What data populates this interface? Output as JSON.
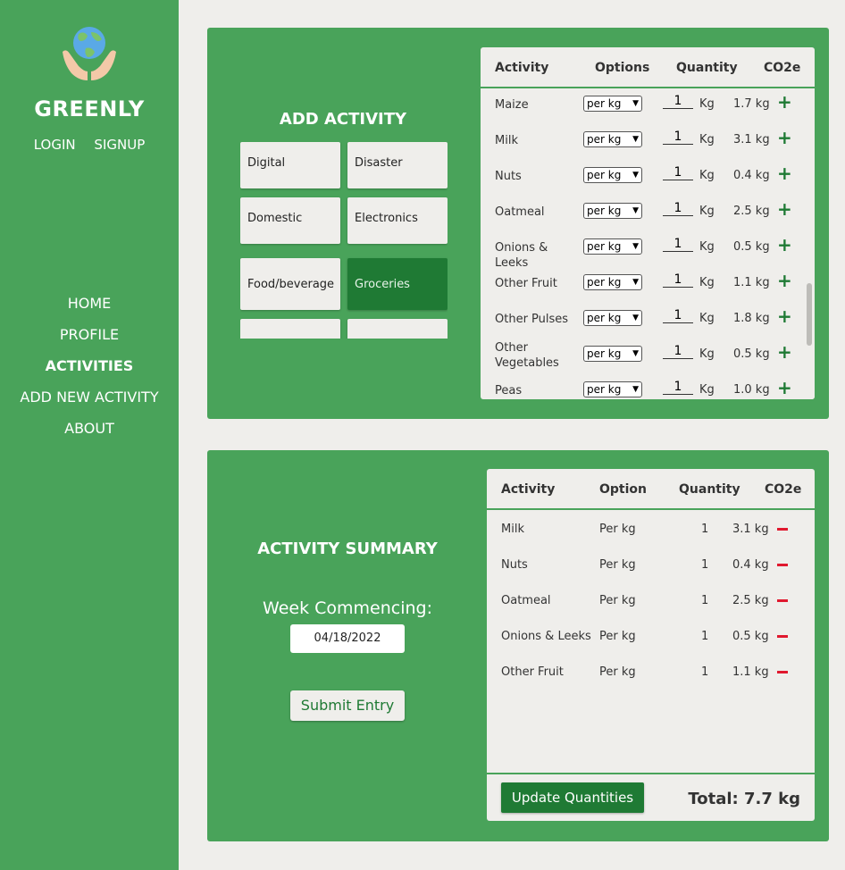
{
  "brand": {
    "name": "GREENLY",
    "logo_icon": "globe-in-hands-icon"
  },
  "auth": {
    "login": "LOGIN",
    "signup": "SIGNUP"
  },
  "nav": [
    {
      "label": "HOME",
      "active": false
    },
    {
      "label": "PROFILE",
      "active": false
    },
    {
      "label": "ACTIVITIES",
      "active": true
    },
    {
      "label": "ADD NEW ACTIVITY",
      "active": false
    },
    {
      "label": "ABOUT",
      "active": false
    }
  ],
  "add_activity": {
    "title": "ADD ACTIVITY",
    "categories": [
      "Digital",
      "Disaster",
      "Domestic",
      "Electronics",
      "Food/beverage",
      "Groceries",
      "",
      ""
    ],
    "selected_category": "Groceries",
    "table": {
      "headers": {
        "activity": "Activity",
        "options": "Options",
        "quantity": "Quantity",
        "co2e": "CO2e"
      },
      "rows": [
        {
          "activity": "Maize",
          "option": "per kg",
          "qty": "1",
          "unit": "Kg",
          "co2e": "1.7 kg"
        },
        {
          "activity": "Milk",
          "option": "per kg",
          "qty": "1",
          "unit": "Kg",
          "co2e": "3.1 kg"
        },
        {
          "activity": "Nuts",
          "option": "per kg",
          "qty": "1",
          "unit": "Kg",
          "co2e": "0.4 kg"
        },
        {
          "activity": "Oatmeal",
          "option": "per kg",
          "qty": "1",
          "unit": "Kg",
          "co2e": "2.5 kg"
        },
        {
          "activity": "Onions & Leeks",
          "option": "per kg",
          "qty": "1",
          "unit": "Kg",
          "co2e": "0.5 kg"
        },
        {
          "activity": "Other Fruit",
          "option": "per kg",
          "qty": "1",
          "unit": "Kg",
          "co2e": "1.1 kg"
        },
        {
          "activity": "Other Pulses",
          "option": "per kg",
          "qty": "1",
          "unit": "Kg",
          "co2e": "1.8 kg"
        },
        {
          "activity": "Other Vegetables",
          "option": "per kg",
          "qty": "1",
          "unit": "Kg",
          "co2e": "0.5 kg"
        },
        {
          "activity": "Peas",
          "option": "per kg",
          "qty": "1",
          "unit": "Kg",
          "co2e": "1.0 kg"
        }
      ]
    }
  },
  "summary": {
    "title": "ACTIVITY SUMMARY",
    "week_label": "Week Commencing:",
    "week_value": "04/18/2022",
    "submit_label": "Submit Entry",
    "table": {
      "headers": {
        "activity": "Activity",
        "option": "Option",
        "quantity": "Quantity",
        "co2e": "CO2e"
      },
      "rows": [
        {
          "activity": "Milk",
          "option": "Per kg",
          "qty": "1",
          "co2e": "3.1 kg"
        },
        {
          "activity": "Nuts",
          "option": "Per kg",
          "qty": "1",
          "co2e": "0.4 kg"
        },
        {
          "activity": "Oatmeal",
          "option": "Per kg",
          "qty": "1",
          "co2e": "2.5 kg"
        },
        {
          "activity": "Onions & Leeks",
          "option": "Per kg",
          "qty": "1",
          "co2e": "0.5 kg"
        },
        {
          "activity": "Other Fruit",
          "option": "Per kg",
          "qty": "1",
          "co2e": "1.1 kg"
        }
      ]
    },
    "update_label": "Update Quantities",
    "total": "Total: 7.7 kg"
  },
  "colors": {
    "primary": "#49a35a",
    "dark": "#1f7a34",
    "bg": "#efeeeb",
    "remove": "#e0182e"
  }
}
